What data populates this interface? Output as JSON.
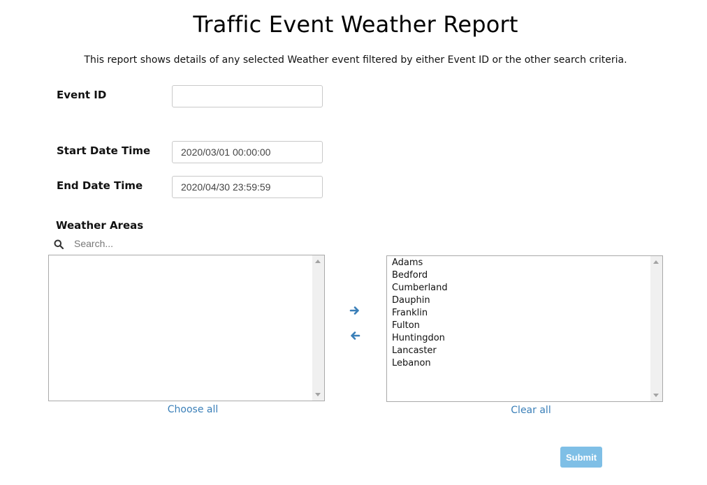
{
  "page": {
    "title": "Traffic Event Weather Report",
    "description": "This report shows details of any selected Weather event filtered by either Event ID or the other search criteria."
  },
  "form": {
    "event_id": {
      "label": "Event ID",
      "value": "",
      "placeholder": ""
    },
    "start_date_time": {
      "label": "Start Date Time",
      "value": "2020/03/01 00:00:00"
    },
    "end_date_time": {
      "label": "End Date Time",
      "value": "2020/04/30 23:59:59"
    },
    "weather_areas": {
      "label": "Weather Areas",
      "search_placeholder": "Search...",
      "available": [],
      "selected": [
        "Adams",
        "Bedford",
        "Cumberland",
        "Dauphin",
        "Franklin",
        "Fulton",
        "Huntingdon",
        "Lancaster",
        "Lebanon"
      ],
      "choose_all_label": "Choose all",
      "clear_all_label": "Clear all",
      "move_right_icon": "arrow-right-icon",
      "move_left_icon": "arrow-left-icon"
    },
    "submit_label": "Submit"
  },
  "colors": {
    "link": "#3a7fb8",
    "submit_bg": "#7fbfe6",
    "arrow": "#3a7fb8"
  }
}
